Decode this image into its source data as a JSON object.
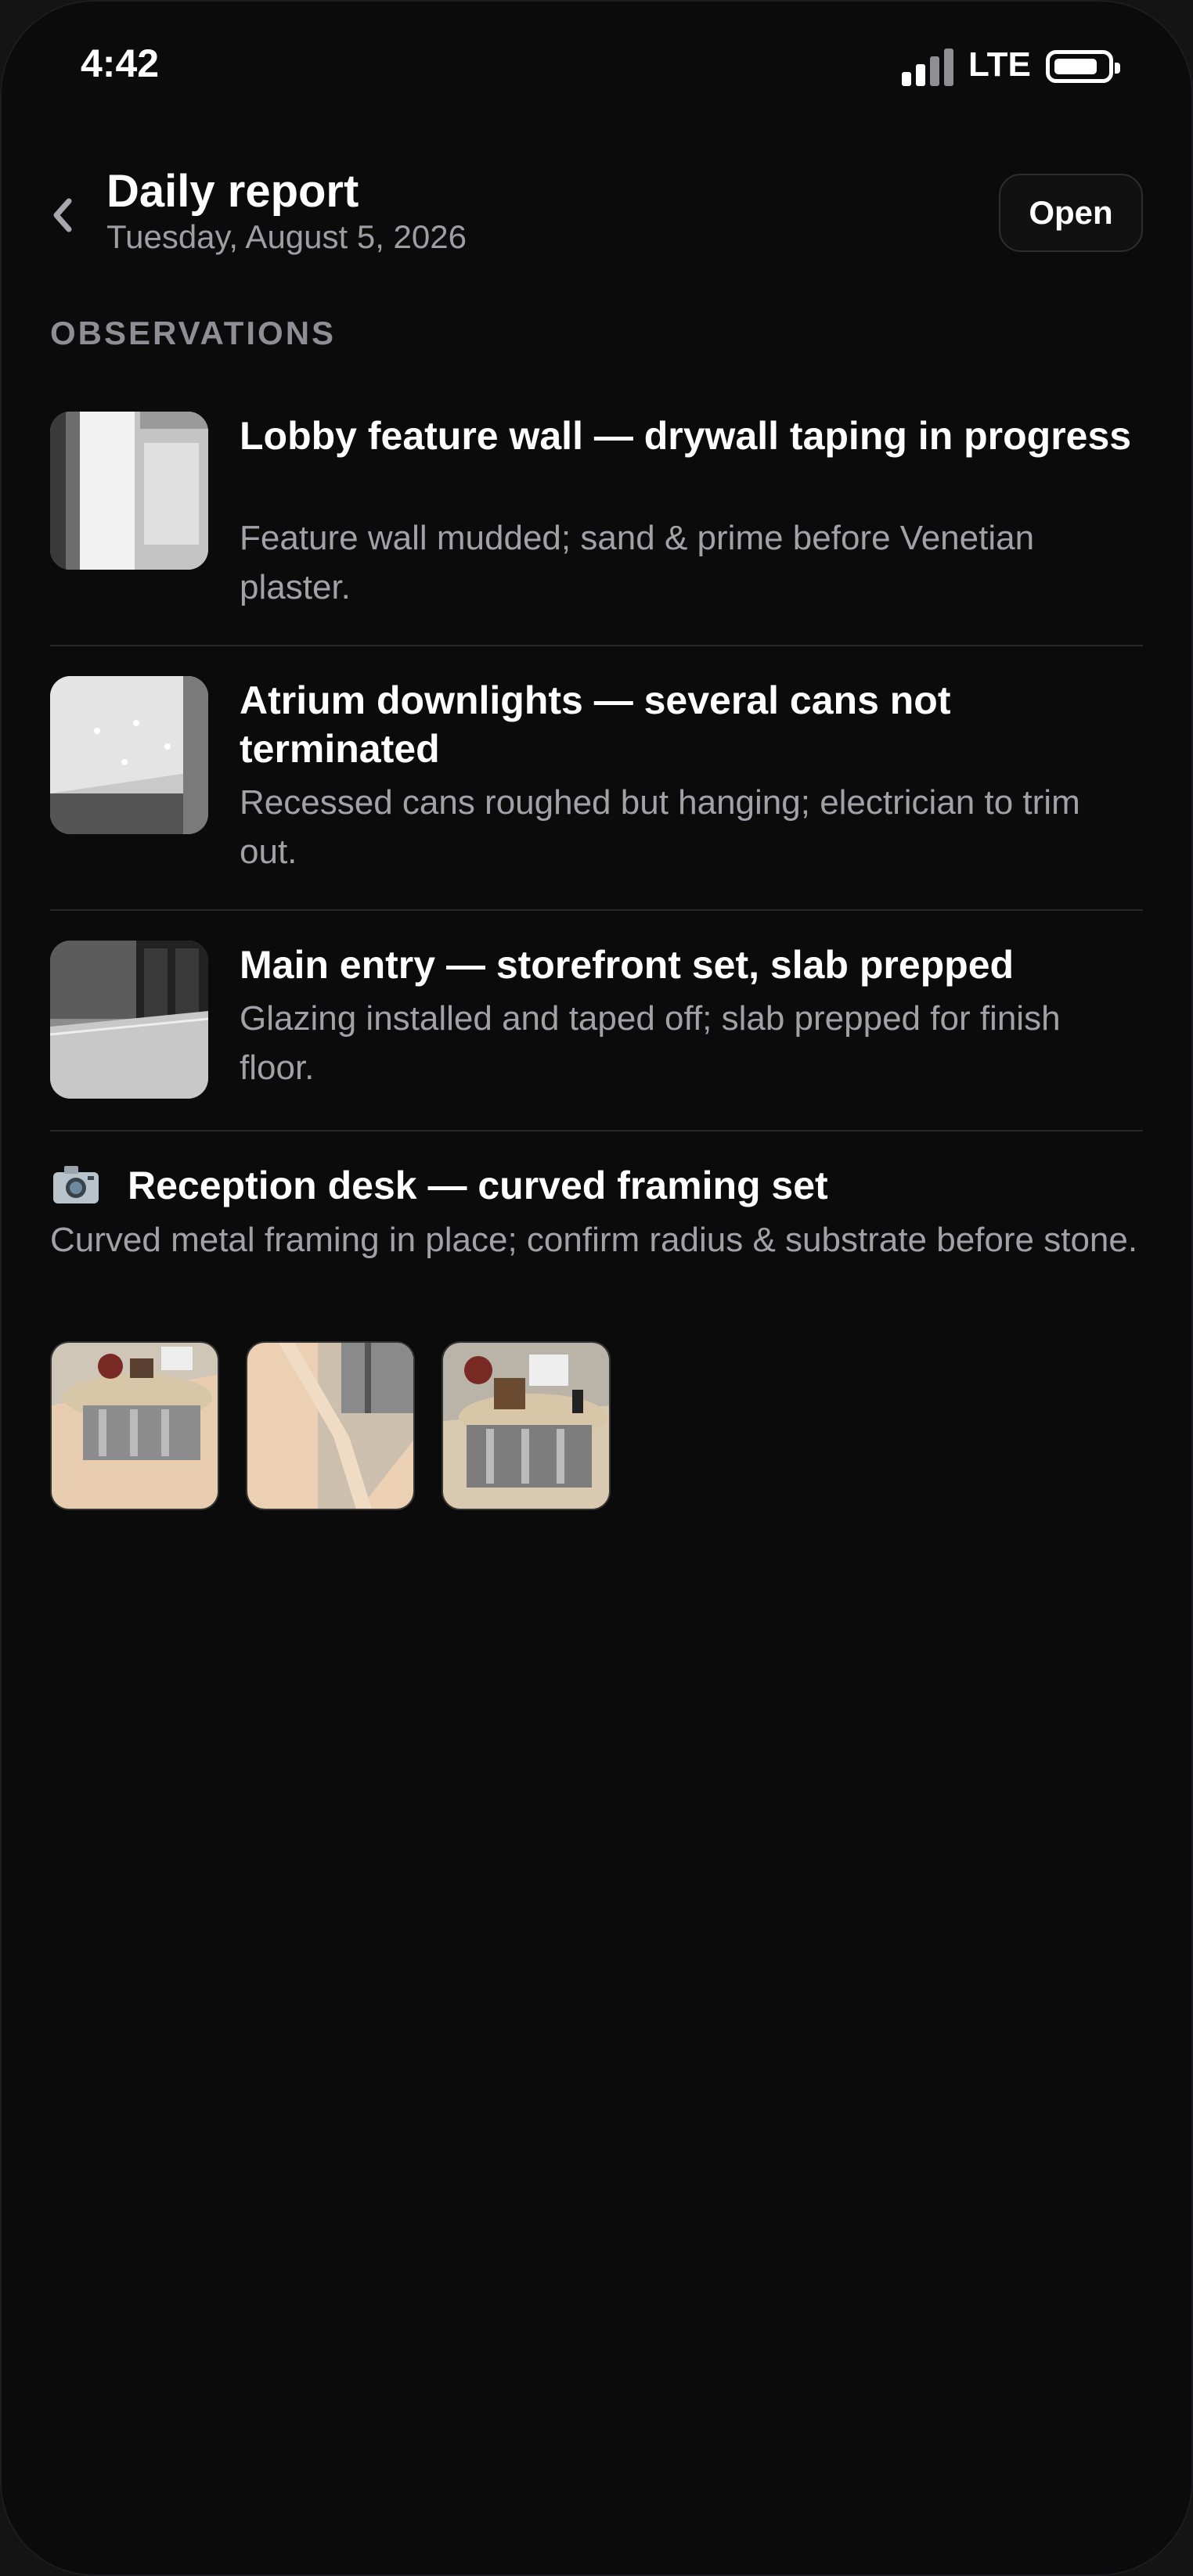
{
  "status_bar": {
    "time": "4:42",
    "network": "LTE"
  },
  "header": {
    "title": "Daily report",
    "date": "Tuesday, August 5, 2026",
    "open_label": "Open"
  },
  "section_label": "OBSERVATIONS",
  "observations": [
    {
      "title": "Lobby feature wall — drywall taping in progress",
      "description": "Feature wall mudded; sand & prime before Venetian plaster."
    },
    {
      "title": "Atrium downlights — several cans not terminated",
      "description": "Recessed cans roughed but hanging; electrician to trim out."
    },
    {
      "title": "Main entry — storefront set, slab prepped",
      "description": "Glazing installed and taped off; slab prepped for finish floor."
    }
  ],
  "reception": {
    "icon": "camera-icon",
    "title": "Reception desk — curved framing set",
    "description": "Curved metal framing in place; confirm radius & substrate before stone.",
    "photo_count": 3
  }
}
